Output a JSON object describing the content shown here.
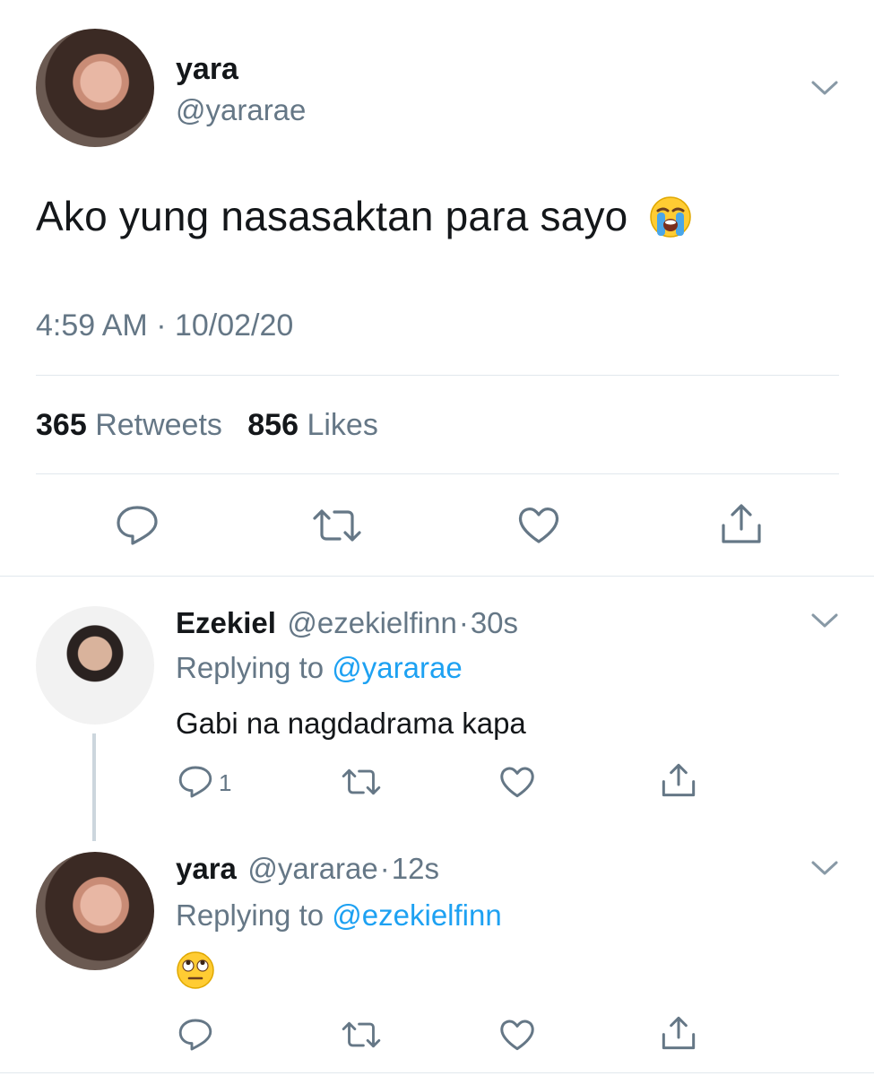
{
  "main_tweet": {
    "name": "yara",
    "handle": "@yararae",
    "text": "Ako yung nasasaktan para sayo",
    "timestamp": "4:59 AM · 10/02/20",
    "retweets_count": "365",
    "retweets_label": "Retweets",
    "likes_count": "856",
    "likes_label": "Likes"
  },
  "replies": [
    {
      "name": "Ezekiel",
      "handle": "@ezekielfinn",
      "separator": "·",
      "time": "30s",
      "replying_label": "Replying to",
      "replying_to": "@yararae",
      "text": "Gabi na nagdadrama kapa",
      "reply_count": "1"
    },
    {
      "name": "yara",
      "handle": "@yararae",
      "separator": "·",
      "time": "12s",
      "replying_label": "Replying to",
      "replying_to": "@ezekielfinn"
    }
  ],
  "icons": {
    "reply": "reply-icon",
    "retweet": "retweet-icon",
    "like": "heart-icon",
    "share": "share-icon",
    "menu": "chevron-down-icon",
    "emoji_main": "loudly-crying-face-emoji",
    "emoji_reply": "face-with-rolling-eyes-emoji"
  },
  "colors": {
    "accent": "#1da1f2",
    "secondary_text": "#657786",
    "primary_text": "#14171a",
    "divider": "#e1e8ed"
  }
}
